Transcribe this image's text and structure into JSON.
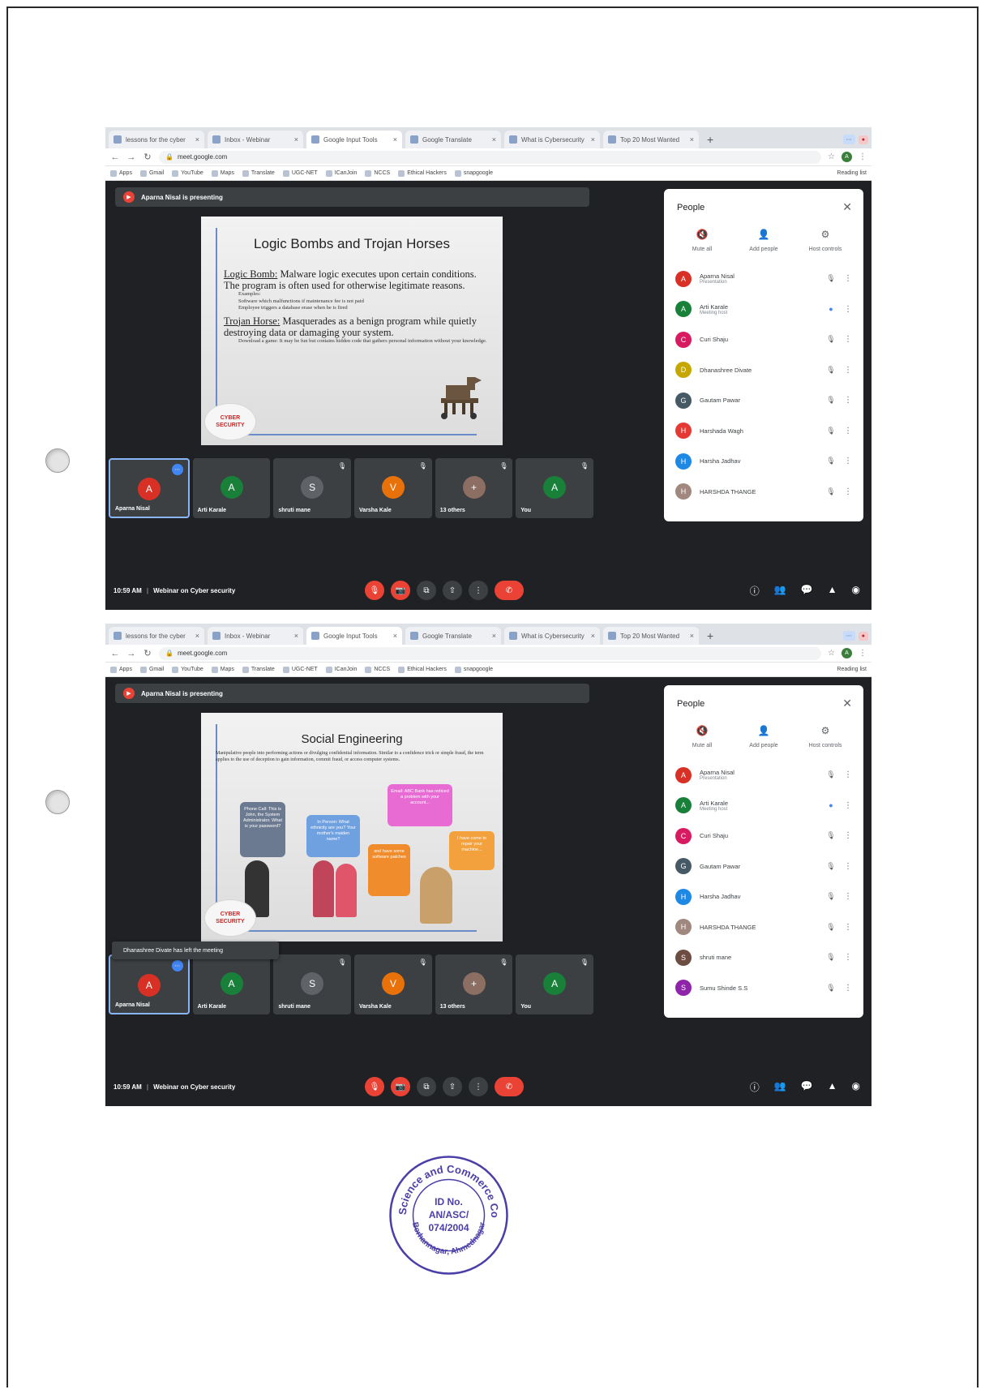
{
  "document": {
    "seal": {
      "outer_text": "Arts, Science and Commerce College",
      "bottom_text": "Borhannagar, Ahmednagar",
      "id_line1": "ID No.",
      "id_line2": "AN/ASC/",
      "id_line3": "074/2004",
      "color": "#4a3fa8"
    }
  },
  "screenshots": [
    {
      "browser": {
        "tabs": [
          {
            "label": "lessons for the cyber"
          },
          {
            "label": "Inbox - Webinar"
          },
          {
            "label": "Google Input Tools"
          },
          {
            "label": "Google Translate"
          },
          {
            "label": "What is Cybersecurity"
          },
          {
            "label": "Top 20 Most Wanted"
          }
        ],
        "new_tab": "+",
        "url": "meet.google.com",
        "bookmarks": [
          {
            "label": "Apps"
          },
          {
            "label": "Gmail"
          },
          {
            "label": "YouTube"
          },
          {
            "label": "Maps"
          },
          {
            "label": "Translate"
          },
          {
            "label": "UGC-NET"
          },
          {
            "label": "ICanJoin"
          },
          {
            "label": "NCCS"
          },
          {
            "label": "Ethical Hackers"
          },
          {
            "label": "snapgoogle"
          }
        ],
        "bookmarks_right": "Reading list"
      },
      "meet": {
        "presenting": "Aparna Nisal is presenting",
        "slide": {
          "title": "Logic Bombs and Trojan Horses",
          "lines": [
            {
              "type": "main",
              "term": "Logic Bomb:",
              "text": " Malware logic executes upon certain conditions. The program is often used for otherwise legitimate reasons."
            },
            {
              "type": "sub",
              "text": "Examples:"
            },
            {
              "type": "sub",
              "text": "Software which malfunctions if maintenance fee is not paid"
            },
            {
              "type": "sub",
              "text": "Employee triggers a database erase when he is fired"
            },
            {
              "type": "main",
              "term": "Trojan Horse:",
              "text": " Masquerades as a benign program while quietly destroying data or damaging your system."
            },
            {
              "type": "sub",
              "text": "Download a game: It may be fun but contains hidden code that gathers personal information without your knowledge."
            }
          ],
          "badge_line1": "CYBER",
          "badge_line2": "SECURITY"
        },
        "tiles": [
          {
            "name": "Aparna Nisal",
            "initial": "A",
            "color": "#d93025",
            "pinned": true,
            "speaking": true
          },
          {
            "name": "Arti Karale",
            "initial": "A",
            "color": "#188038"
          },
          {
            "name": "shruti mane",
            "initial": "S",
            "color": "#5f6368",
            "muted": true
          },
          {
            "name": "Varsha Kale",
            "initial": "V",
            "color": "#e8710a",
            "muted": true
          },
          {
            "name": "13 others",
            "initial": "+",
            "color": "#8d6e63",
            "muted": true
          },
          {
            "name": "You",
            "initial": "A",
            "color": "#188038",
            "muted": true
          }
        ],
        "time": "10:59 AM",
        "meeting_title": "Webinar on Cyber security",
        "people_panel": {
          "title": "People",
          "actions": [
            "Mute all",
            "Add people",
            "Host controls"
          ],
          "participants": [
            {
              "name": "Aparna Nisal",
              "role": "Presentation",
              "initial": "A",
              "color": "#d93025",
              "mic": "muted"
            },
            {
              "name": "Arti Karale",
              "role": "Meeting host",
              "initial": "A",
              "color": "#188038",
              "mic": "live"
            },
            {
              "name": "Curi Shaju",
              "role": "",
              "initial": "C",
              "color": "#d81b60",
              "mic": "muted"
            },
            {
              "name": "Dhanashree Divate",
              "role": "",
              "initial": "D",
              "color": "#c6a700",
              "mic": "muted"
            },
            {
              "name": "Gautam Pawar",
              "role": "",
              "initial": "G",
              "color": "#455a64",
              "mic": "muted"
            },
            {
              "name": "Harshada Wagh",
              "role": "",
              "initial": "H",
              "color": "#e53935",
              "mic": "muted"
            },
            {
              "name": "Harsha Jadhav",
              "role": "",
              "initial": "H",
              "color": "#1e88e5",
              "mic": "muted"
            },
            {
              "name": "HARSHDA THANGE",
              "role": "",
              "initial": "H",
              "color": "#a1887f",
              "mic": "muted"
            }
          ]
        }
      }
    },
    {
      "browser": {
        "tabs": [
          {
            "label": "lessons for the cyber"
          },
          {
            "label": "Inbox - Webinar"
          },
          {
            "label": "Google Input Tools"
          },
          {
            "label": "Google Translate"
          },
          {
            "label": "What is Cybersecurity"
          },
          {
            "label": "Top 20 Most Wanted"
          }
        ],
        "new_tab": "+",
        "url": "meet.google.com",
        "bookmarks": [
          {
            "label": "Apps"
          },
          {
            "label": "Gmail"
          },
          {
            "label": "YouTube"
          },
          {
            "label": "Maps"
          },
          {
            "label": "Translate"
          },
          {
            "label": "UGC-NET"
          },
          {
            "label": "ICanJoin"
          },
          {
            "label": "NCCS"
          },
          {
            "label": "Ethical Hackers"
          },
          {
            "label": "snapgoogle"
          }
        ],
        "bookmarks_right": "Reading list"
      },
      "meet": {
        "presenting": "Aparna Nisal is presenting",
        "slide": {
          "title": "Social Engineering",
          "intro": "Manipulative people into performing actions or divulging confidential information. Similar to a confidence trick or simple fraud, the term applies to the use of deception to gain information, commit fraud, or access computer systems.",
          "bubbles": [
            {
              "text": "Phone Call: This is John, the System Administrator. What is your password?"
            },
            {
              "text": "In Person: What ethnicity are you? Your mother's maiden name?"
            },
            {
              "text": "Email: ABC Bank has noticed a problem with your account..."
            },
            {
              "text": "and have some software patches"
            },
            {
              "text": "I have come to repair your machine..."
            }
          ],
          "badge_line1": "CYBER",
          "badge_line2": "SECURITY"
        },
        "toast": "Dhanashree Divate has left the meeting",
        "tiles": [
          {
            "name": "Aparna Nisal",
            "initial": "A",
            "color": "#d93025",
            "pinned": true,
            "speaking": true
          },
          {
            "name": "Arti Karale",
            "initial": "A",
            "color": "#188038"
          },
          {
            "name": "shruti mane",
            "initial": "S",
            "color": "#5f6368",
            "muted": true
          },
          {
            "name": "Varsha Kale",
            "initial": "V",
            "color": "#e8710a",
            "muted": true
          },
          {
            "name": "13 others",
            "initial": "+",
            "color": "#8d6e63",
            "muted": true
          },
          {
            "name": "You",
            "initial": "A",
            "color": "#188038",
            "muted": true
          }
        ],
        "time": "10:59 AM",
        "meeting_title": "Webinar on Cyber security",
        "people_panel": {
          "title": "People",
          "actions": [
            "Mute all",
            "Add people",
            "Host controls"
          ],
          "participants": [
            {
              "name": "Aparna Nisal",
              "role": "Presentation",
              "initial": "A",
              "color": "#d93025",
              "mic": "muted"
            },
            {
              "name": "Arti Karale",
              "role": "Meeting host",
              "initial": "A",
              "color": "#188038",
              "mic": "live"
            },
            {
              "name": "Curi Shaju",
              "role": "",
              "initial": "C",
              "color": "#d81b60",
              "mic": "muted"
            },
            {
              "name": "Gautam Pawar",
              "role": "",
              "initial": "G",
              "color": "#455a64",
              "mic": "muted"
            },
            {
              "name": "Harsha Jadhav",
              "role": "",
              "initial": "H",
              "color": "#1e88e5",
              "mic": "muted"
            },
            {
              "name": "HARSHDA THANGE",
              "role": "",
              "initial": "H",
              "color": "#a1887f",
              "mic": "muted"
            },
            {
              "name": "shruti mane",
              "role": "",
              "initial": "S",
              "color": "#6d4c41",
              "mic": "muted"
            },
            {
              "name": "Sumu Shinde S.S",
              "role": "",
              "initial": "S",
              "color": "#8e24aa",
              "mic": "muted"
            }
          ]
        }
      }
    }
  ]
}
